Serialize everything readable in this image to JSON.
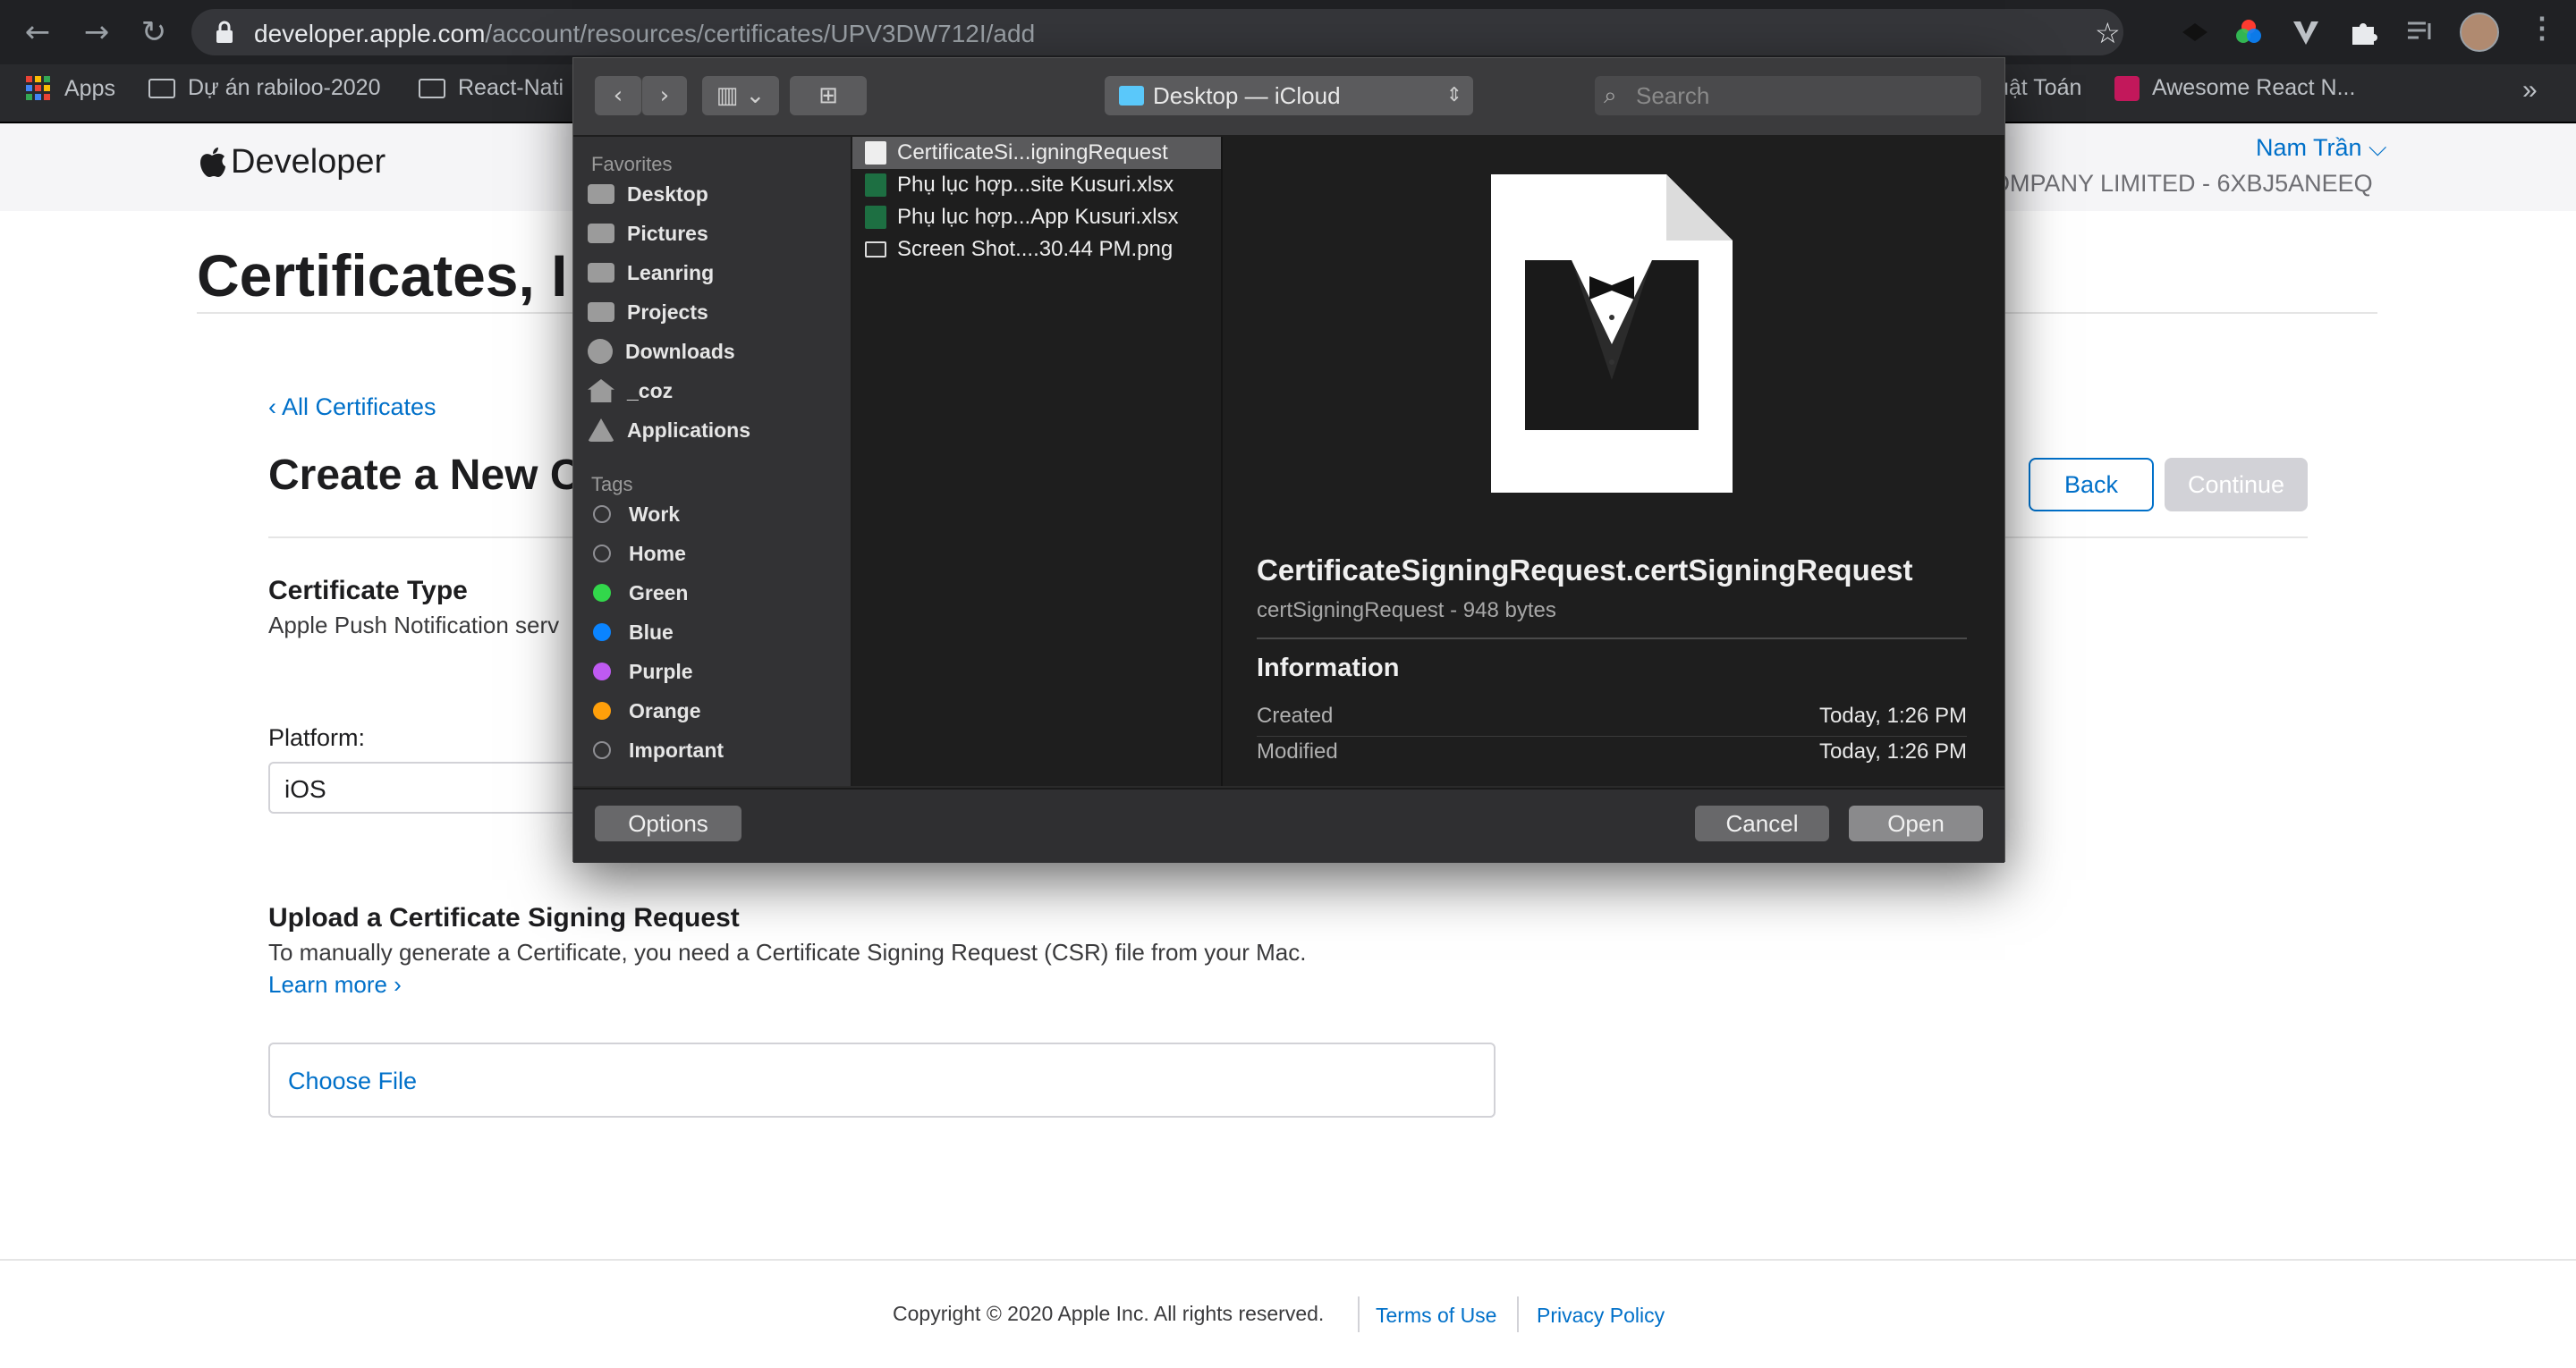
{
  "browser": {
    "url_host": "developer.apple.com",
    "url_path": "/account/resources/certificates/UPV3DW712I/add",
    "bookmarks": [
      {
        "label": "Apps"
      },
      {
        "label": "Dự án rabiloo-2020"
      },
      {
        "label": "React-Nati"
      },
      {
        "label": "uật Toán"
      },
      {
        "label": "Awesome React N..."
      }
    ],
    "more_bookmarks": "»"
  },
  "header": {
    "logo_text": "Developer",
    "user_menu": "Nam Trần ⌵",
    "team": "OMPANY LIMITED - 6XBJ5ANEEQ"
  },
  "page": {
    "title": "Certificates, I",
    "back_link": "‹ All Certificates",
    "section_title": "Create a New C",
    "back_button": "Back",
    "continue_button": "Continue",
    "cert_type_label": "Certificate Type",
    "cert_type_value": "Apple Push Notification serv",
    "platform_label": "Platform:",
    "platform_value": "iOS",
    "upload_title": "Upload a Certificate Signing Request",
    "upload_desc": "To manually generate a Certificate, you need a Certificate Signing Request (CSR) file from your Mac.",
    "learn_more": "Learn more ›",
    "choose_file": "Choose File"
  },
  "dialog": {
    "location": "Desktop — iCloud",
    "search_placeholder": "Search",
    "favorites_header": "Favorites",
    "favorites": [
      {
        "label": "Desktop",
        "icon": "desktop-icon"
      },
      {
        "label": "Pictures",
        "icon": "camera-icon"
      },
      {
        "label": "Leanring",
        "icon": "folder-icon"
      },
      {
        "label": "Projects",
        "icon": "folder-icon"
      },
      {
        "label": "Downloads",
        "icon": "download-icon"
      },
      {
        "label": "_coz",
        "icon": "home-icon"
      },
      {
        "label": "Applications",
        "icon": "applications-icon"
      }
    ],
    "tags_header": "Tags",
    "tags": [
      {
        "label": "Work",
        "color": "#8e8e93",
        "hollow": true
      },
      {
        "label": "Home",
        "color": "#8e8e93",
        "hollow": true
      },
      {
        "label": "Green",
        "color": "#32d74b",
        "hollow": false
      },
      {
        "label": "Blue",
        "color": "#0a84ff",
        "hollow": false
      },
      {
        "label": "Purple",
        "color": "#bf5af2",
        "hollow": false
      },
      {
        "label": "Orange",
        "color": "#ff9f0a",
        "hollow": false
      },
      {
        "label": "Important",
        "color": "#8e8e93",
        "hollow": true
      }
    ],
    "files": [
      {
        "name": "CertificateSi...igningRequest",
        "icon": "certificate-file-icon",
        "selected": true
      },
      {
        "name": "Phụ lục hợp...site Kusuri.xlsx",
        "icon": "excel-file-icon",
        "selected": false
      },
      {
        "name": "Phụ lục hợp...App Kusuri.xlsx",
        "icon": "excel-file-icon",
        "selected": false
      },
      {
        "name": "Screen Shot....30.44 PM.png",
        "icon": "image-file-icon",
        "selected": false
      }
    ],
    "preview": {
      "filename": "CertificateSigningRequest.certSigningRequest",
      "subtitle": "certSigningRequest - 948 bytes",
      "info_header": "Information",
      "rows": [
        {
          "label": "Created",
          "value": "Today, 1:26 PM"
        },
        {
          "label": "Modified",
          "value": "Today, 1:26 PM"
        }
      ]
    },
    "options_button": "Options",
    "cancel_button": "Cancel",
    "open_button": "Open"
  },
  "footer": {
    "copyright": "Copyright © 2020 Apple Inc. All rights reserved.",
    "terms": "Terms of Use",
    "privacy": "Privacy Policy"
  }
}
